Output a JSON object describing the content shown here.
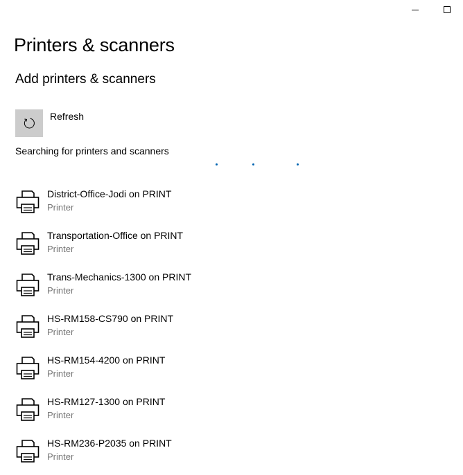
{
  "window": {
    "controls": [
      "minimize",
      "maximize"
    ]
  },
  "page": {
    "title": "Printers & scanners"
  },
  "add_section": {
    "title": "Add printers & scanners",
    "refresh_label": "Refresh",
    "refresh_icon": "refresh-icon",
    "status_text": "Searching for printers and scanners"
  },
  "printers": [
    {
      "name": "District-Office-Jodi on PRINT",
      "type": "Printer",
      "icon": "printer-icon"
    },
    {
      "name": "Transportation-Office on PRINT",
      "type": "Printer",
      "icon": "printer-icon"
    },
    {
      "name": "Trans-Mechanics-1300 on PRINT",
      "type": "Printer",
      "icon": "printer-icon"
    },
    {
      "name": "HS-RM158-CS790 on PRINT",
      "type": "Printer",
      "icon": "printer-icon"
    },
    {
      "name": "HS-RM154-4200 on PRINT",
      "type": "Printer",
      "icon": "printer-icon"
    },
    {
      "name": "HS-RM127-1300 on PRINT",
      "type": "Printer",
      "icon": "printer-icon"
    },
    {
      "name": "HS-RM236-P2035 on PRINT",
      "type": "Printer",
      "icon": "printer-icon"
    }
  ],
  "colors": {
    "accent": "#0063b1",
    "refresh_tile": "#cccccc",
    "secondary_text": "#767676"
  }
}
